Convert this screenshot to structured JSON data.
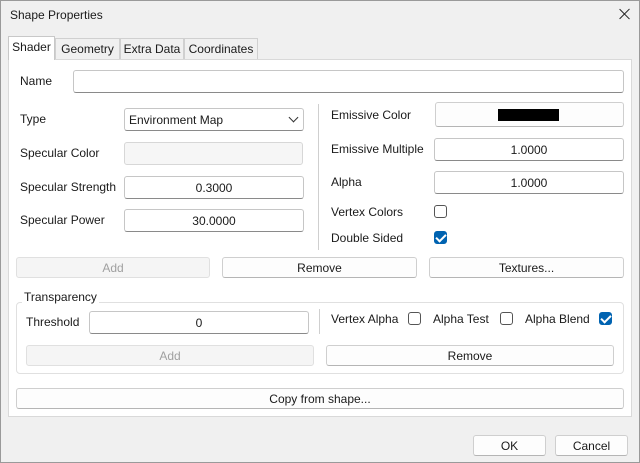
{
  "window": {
    "title": "Shape Properties"
  },
  "tabs": [
    {
      "label": "Shader",
      "active": true
    },
    {
      "label": "Geometry",
      "active": false
    },
    {
      "label": "Extra Data",
      "active": false
    },
    {
      "label": "Coordinates",
      "active": false
    }
  ],
  "name": {
    "label": "Name",
    "value": ""
  },
  "type": {
    "label": "Type",
    "value": "Environment Map"
  },
  "specular_color": {
    "label": "Specular Color",
    "value": ""
  },
  "specular_strength": {
    "label": "Specular Strength",
    "value": "0.3000"
  },
  "specular_power": {
    "label": "Specular Power",
    "value": "30.0000"
  },
  "emissive_color": {
    "label": "Emissive Color",
    "color": "#000000"
  },
  "emissive_multiple": {
    "label": "Emissive Multiple",
    "value": "1.0000"
  },
  "alpha": {
    "label": "Alpha",
    "value": "1.0000"
  },
  "vertex_colors": {
    "label": "Vertex Colors",
    "checked": false
  },
  "double_sided": {
    "label": "Double Sided",
    "checked": true
  },
  "buttons_top": {
    "add": "Add",
    "remove": "Remove",
    "textures": "Textures..."
  },
  "transparency": {
    "title": "Transparency",
    "threshold_label": "Threshold",
    "threshold_value": "0",
    "vertex_alpha": {
      "label": "Vertex Alpha",
      "checked": false
    },
    "alpha_test": {
      "label": "Alpha Test",
      "checked": false
    },
    "alpha_blend": {
      "label": "Alpha Blend",
      "checked": true
    },
    "add": "Add",
    "remove": "Remove"
  },
  "copy_from_shape": "Copy from shape...",
  "footer": {
    "ok": "OK",
    "cancel": "Cancel"
  },
  "colors": {
    "accent": "#0063b1"
  }
}
